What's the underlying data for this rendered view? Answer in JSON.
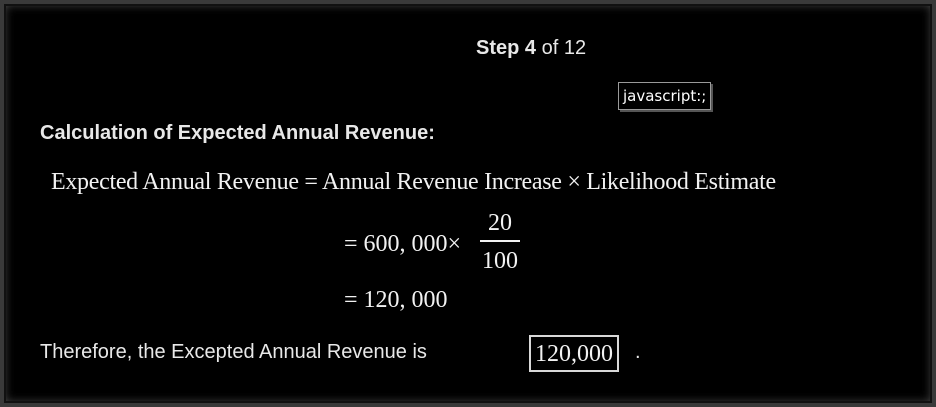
{
  "step": {
    "label": "Step",
    "current": "4",
    "of_text": "of 12"
  },
  "tooltip": {
    "text": "javascript:;"
  },
  "heading": "Calculation of Expected Annual Revenue:",
  "equations": {
    "line1": "Expected Annual Revenue = Annual Revenue Increase × Likelihood Estimate",
    "line2_prefix": "= 600, 000×",
    "fraction_numerator": "20",
    "fraction_denominator": "100",
    "line3": "= 120, 000"
  },
  "conclusion": {
    "text": "Therefore, the Excepted Annual Revenue is",
    "answer": "120,000",
    "end": "."
  }
}
